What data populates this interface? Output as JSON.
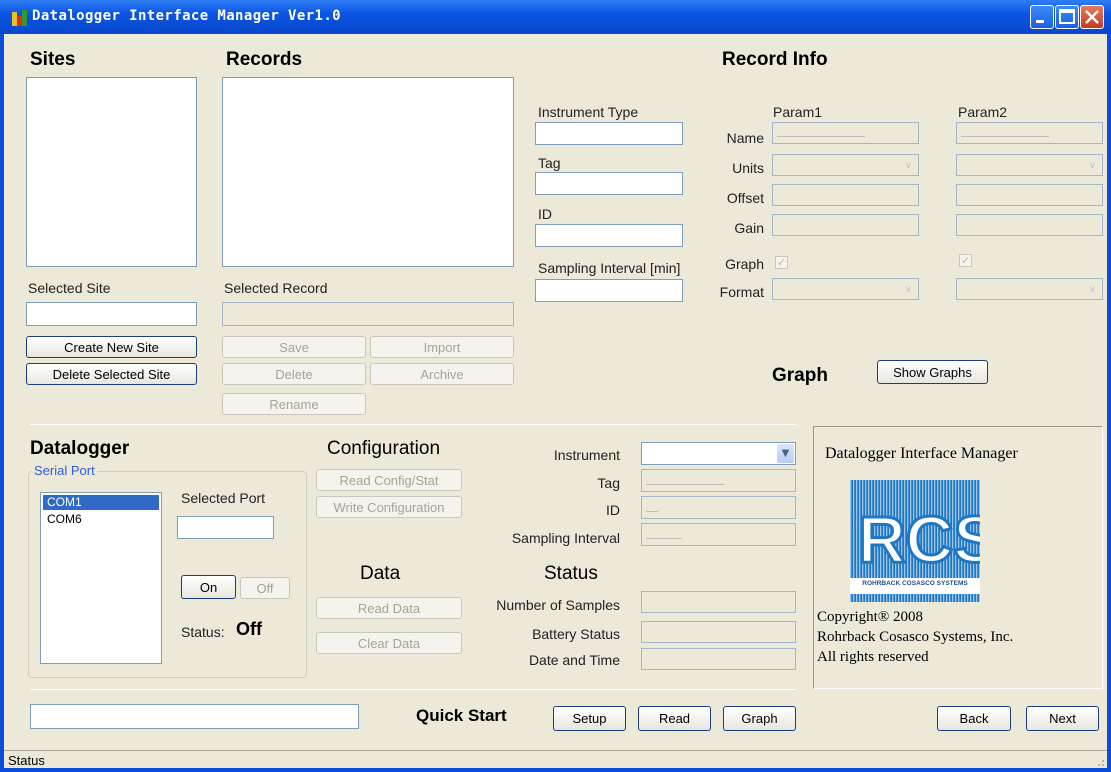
{
  "window": {
    "title": "Datalogger Interface Manager Ver1.0"
  },
  "sites": {
    "heading": "Sites",
    "selected_label": "Selected Site",
    "selected_value": "",
    "create_btn": "Create New Site",
    "delete_btn": "Delete Selected Site"
  },
  "records": {
    "heading": "Records",
    "selected_label": "Selected Record",
    "save_btn": "Save",
    "import_btn": "Import",
    "delete_btn": "Delete",
    "archive_btn": "Archive",
    "rename_btn": "Rename"
  },
  "instrument_fields": {
    "type_label": "Instrument Type",
    "tag_label": "Tag",
    "id_label": "ID",
    "interval_label": "Sampling Interval [min]"
  },
  "record_info": {
    "heading": "Record Info",
    "param1": "Param1",
    "param2": "Param2",
    "name_label": "Name",
    "units_label": "Units",
    "offset_label": "Offset",
    "gain_label": "Gain",
    "graph_label": "Graph",
    "format_label": "Format",
    "graph_checked_1": true,
    "graph_checked_2": true
  },
  "graph": {
    "heading": "Graph",
    "show_btn": "Show Graphs"
  },
  "datalogger": {
    "heading": "Datalogger",
    "serial_port_legend": "Serial Port",
    "ports": [
      "COM1",
      "COM6"
    ],
    "selected_index": 0,
    "selected_port_label": "Selected Port",
    "on_btn": "On",
    "off_btn": "Off",
    "status_label": "Status:",
    "status_value": "Off"
  },
  "configuration": {
    "heading": "Configuration",
    "read_btn": "Read Config/Stat",
    "write_btn": "Write Configuration"
  },
  "data": {
    "heading": "Data",
    "read_btn": "Read Data",
    "clear_btn": "Clear Data"
  },
  "device": {
    "instrument_label": "Instrument",
    "tag_label": "Tag",
    "id_label": "ID",
    "interval_label": "Sampling Interval"
  },
  "status_section": {
    "heading": "Status",
    "samples_label": "Number of Samples",
    "battery_label": "Battery Status",
    "datetime_label": "Date and Time"
  },
  "about": {
    "title": "Datalogger Interface Manager",
    "logo_sub": "ROHRBACK COSASCO SYSTEMS",
    "copyright": "Copyright® 2008",
    "company": "Rohrback Cosasco Systems, Inc.",
    "rights": "All rights reserved"
  },
  "quick": {
    "label": "Quick Start",
    "setup_btn": "Setup",
    "read_btn": "Read",
    "graph_btn": "Graph",
    "back_btn": "Back",
    "next_btn": "Next"
  },
  "statusbar": {
    "text": "Status"
  }
}
